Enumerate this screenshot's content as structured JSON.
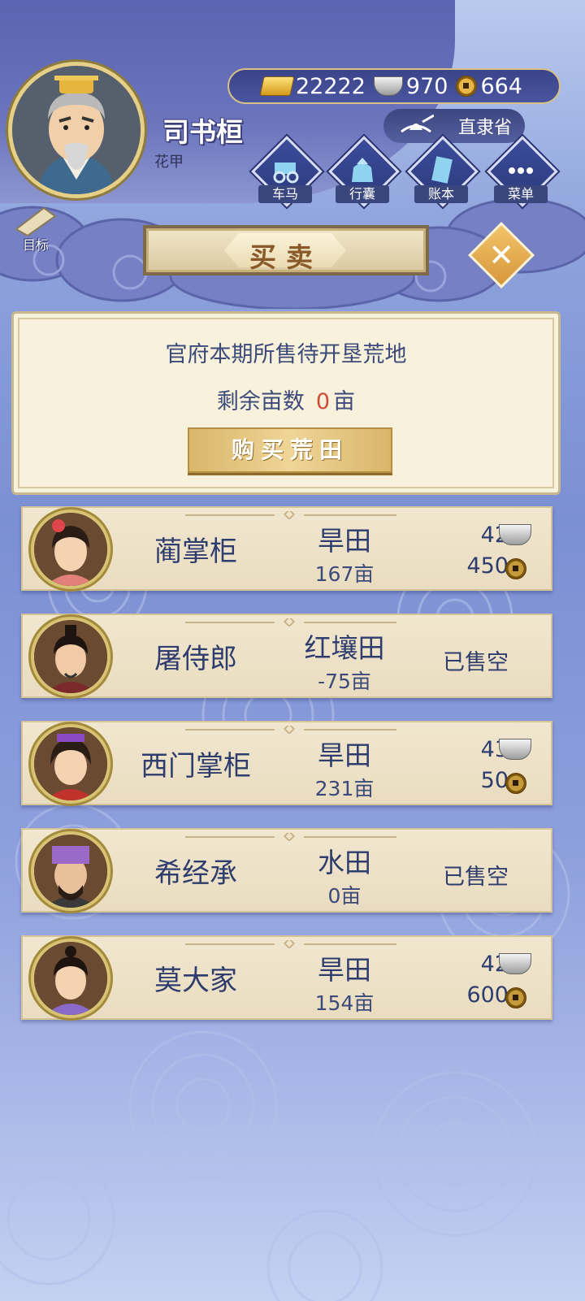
{
  "player": {
    "name": "司书桓",
    "title": "花甲"
  },
  "currency": {
    "gold": "22222",
    "silver": "970",
    "copper": "664"
  },
  "province": "直隶省",
  "menu": [
    {
      "label": "车马",
      "icon": "carriage-icon"
    },
    {
      "label": "行囊",
      "icon": "bag-icon"
    },
    {
      "label": "账本",
      "icon": "ledger-icon"
    },
    {
      "label": "菜单",
      "icon": "more-icon"
    }
  ],
  "target_label": "目标",
  "trade_title": "买卖",
  "panel": {
    "heading": "官府本期所售待开垦荒地",
    "remaining_label": "剩余亩数",
    "remaining_value": "0",
    "remaining_unit": "亩",
    "buy_button": "购买荒田"
  },
  "sellers": [
    {
      "name": "蔺掌柜",
      "land": "旱田",
      "acres": "167亩",
      "silver": "42",
      "copper": "450",
      "sold_out": false
    },
    {
      "name": "屠侍郎",
      "land": "红壤田",
      "acres": "-75亩",
      "sold_text": "已售空",
      "sold_out": true
    },
    {
      "name": "西门掌柜",
      "land": "旱田",
      "acres": "231亩",
      "silver": "43",
      "copper": "50",
      "sold_out": false
    },
    {
      "name": "希经承",
      "land": "水田",
      "acres": "0亩",
      "sold_text": "已售空",
      "sold_out": true
    },
    {
      "name": "莫大家",
      "land": "旱田",
      "acres": "154亩",
      "silver": "42",
      "copper": "600",
      "sold_out": false
    }
  ]
}
